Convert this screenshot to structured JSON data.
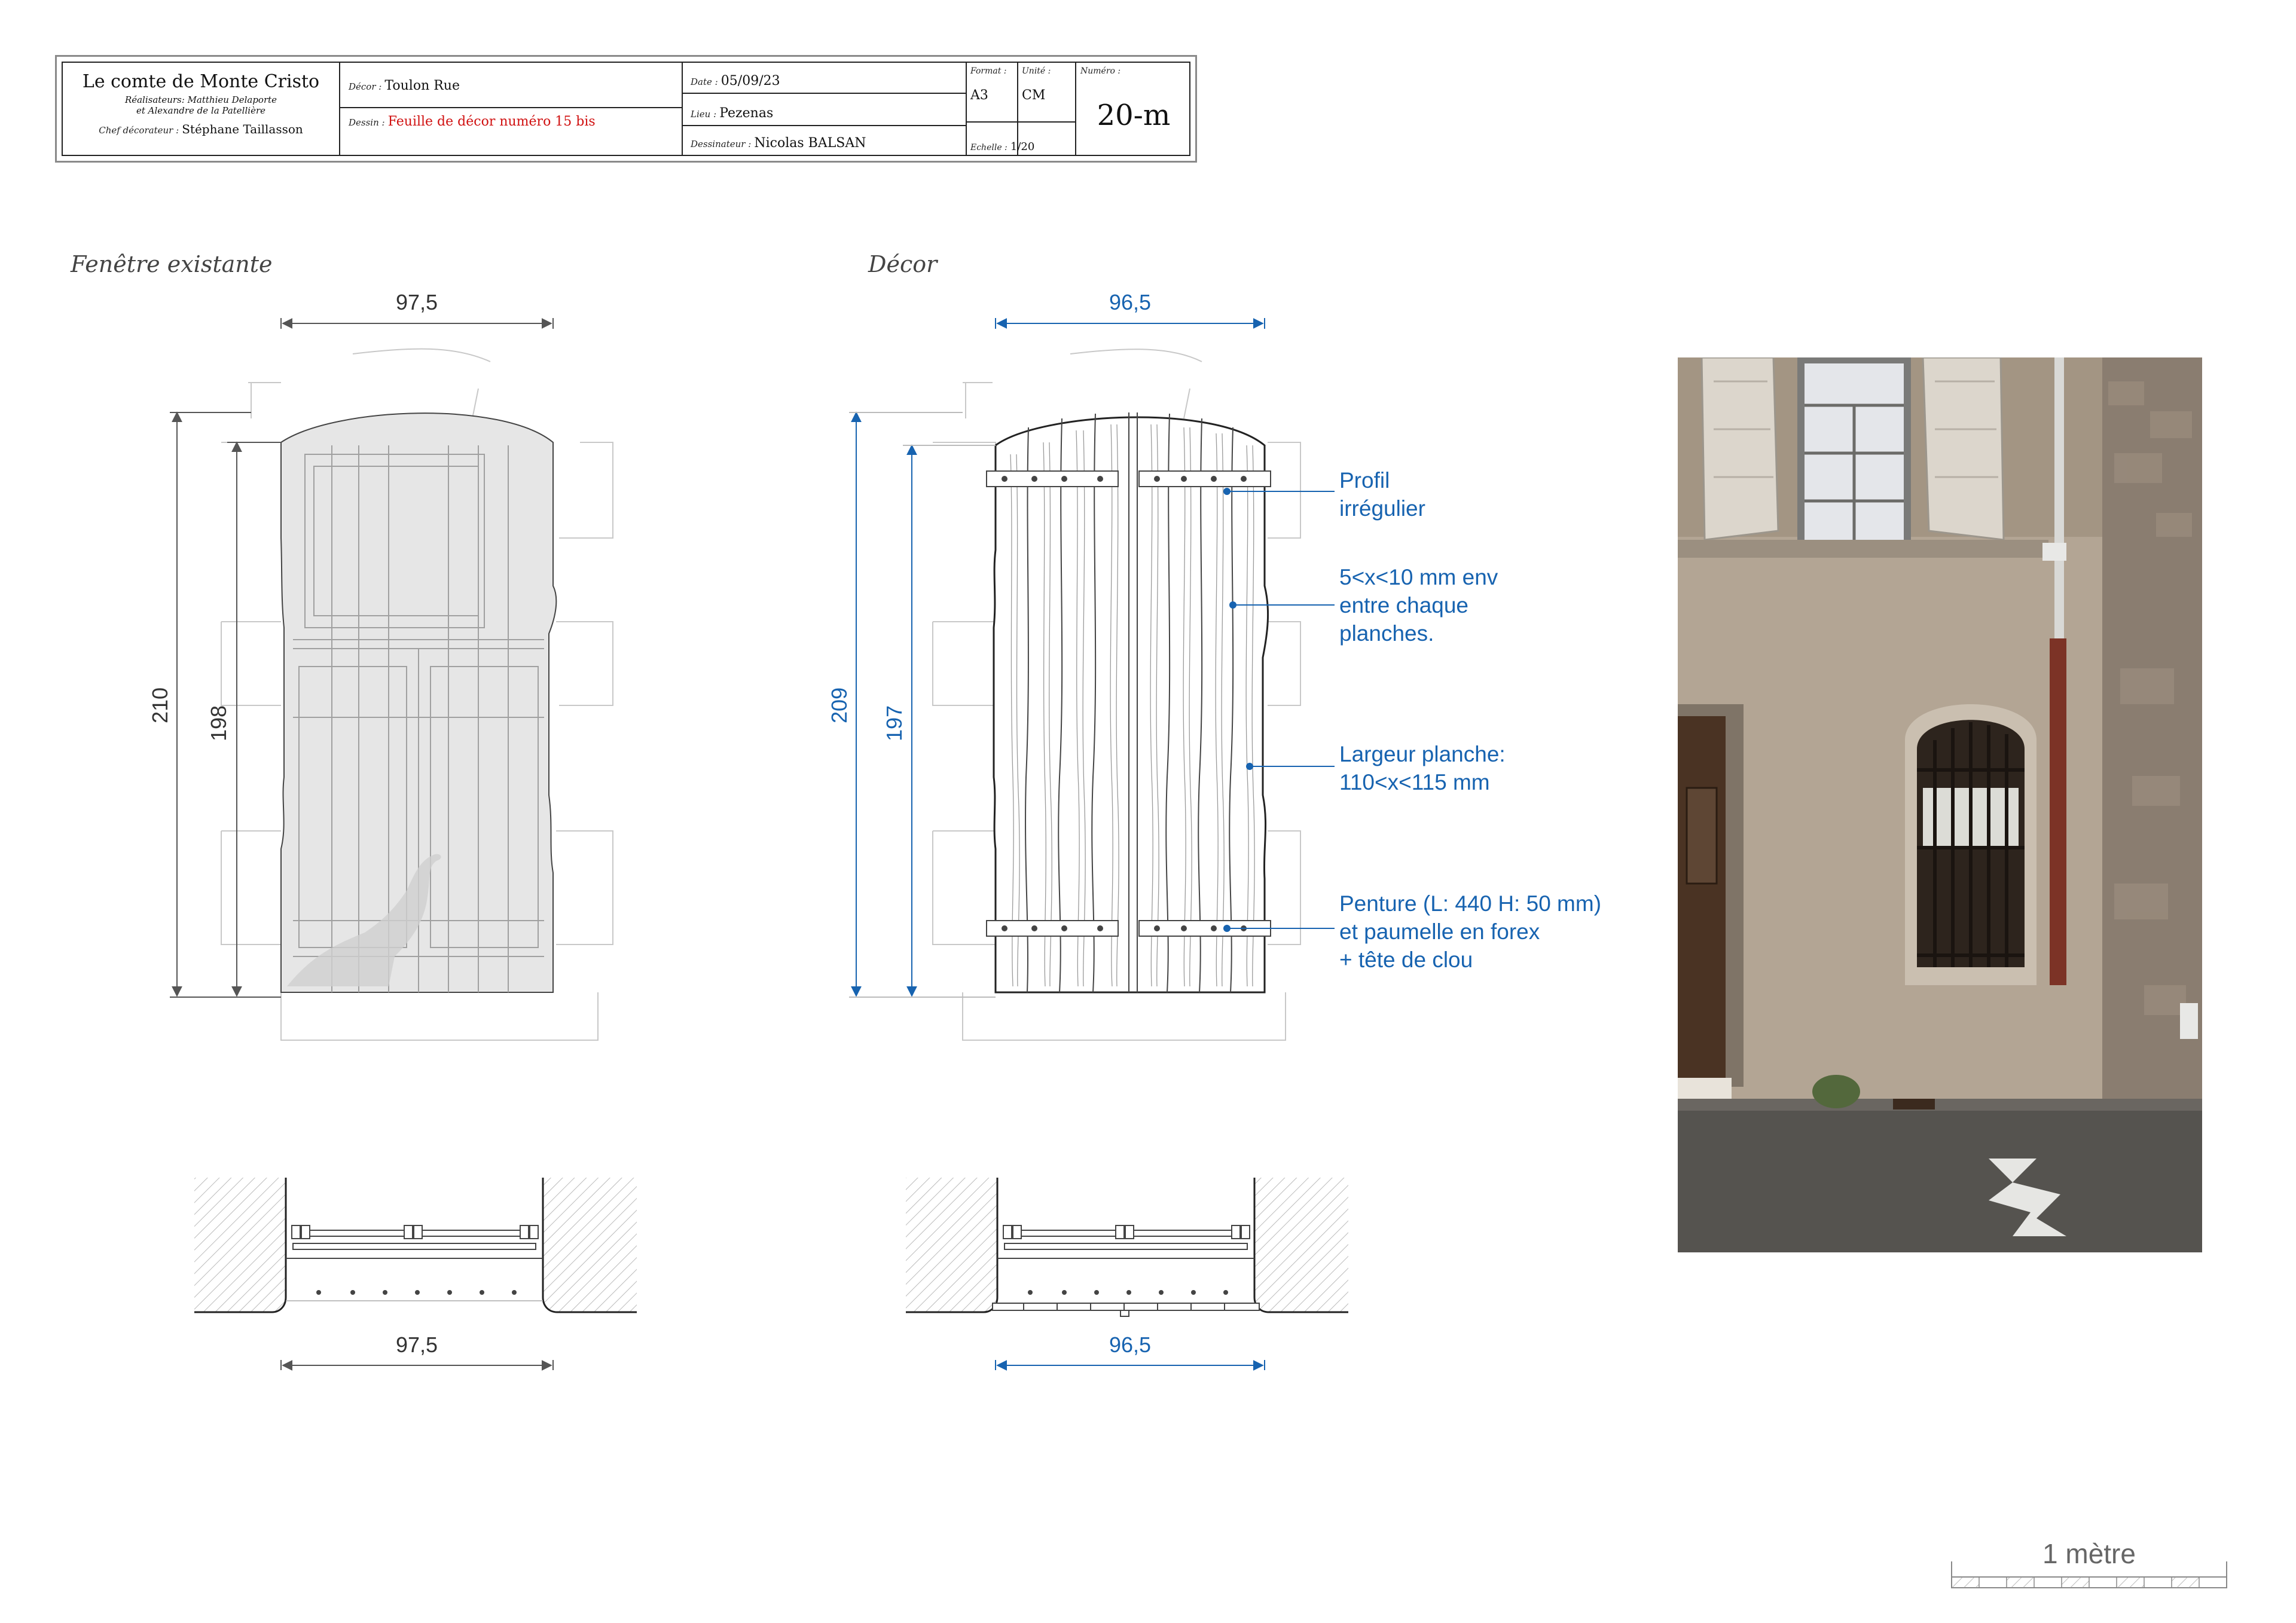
{
  "title_block": {
    "film_title": "Le comte de Monte Cristo",
    "directors_label": "Réalisateurs:",
    "directors_line1": "Matthieu Delaporte",
    "directors_line2": "et Alexandre de la Patellière",
    "chief_decorator_label": "Chef décorateur :",
    "chief_decorator": "Stéphane Taillasson",
    "decor_label": "Décor :",
    "decor": "Toulon Rue",
    "dessin_label": "Dessin :",
    "dessin": "Feuille de décor numéro 15 bis",
    "date_label": "Date :",
    "date": "05/09/23",
    "lieu_label": "Lieu :",
    "lieu": "Pezenas",
    "dessinateur_label": "Dessinateur :",
    "dessinateur": "Nicolas BALSAN",
    "format_label": "Format :",
    "format": "A3",
    "unite_label": "Unité :",
    "unite": "CM",
    "echelle_label": "Echelle :",
    "echelle": "1/20",
    "numero_label": "Numéro :",
    "numero": "20-m"
  },
  "views": {
    "existing": {
      "heading": "Fenêtre existante",
      "width_top": "97,5",
      "height_outer": "210",
      "height_inner": "198",
      "width_bottom": "97,5"
    },
    "decor": {
      "heading": "Décor",
      "width_top": "96,5",
      "height_outer": "209",
      "height_inner": "197",
      "width_bottom": "96,5"
    }
  },
  "annotations": {
    "profil": "Profil\nirrégulier",
    "gap": "5<x<10 mm env\nentre chaque\nplanches.",
    "plank": "Largeur planche:\n110<x<115 mm",
    "penture": "Penture (L: 440 H: 50 mm)\net paumelle en forex\n+ tête de clou"
  },
  "scale_bar": {
    "label": "1 mètre"
  },
  "colors": {
    "annotation_blue": "#1763b0",
    "title_red": "#d01010",
    "line_gray": "#bbbbbb"
  }
}
